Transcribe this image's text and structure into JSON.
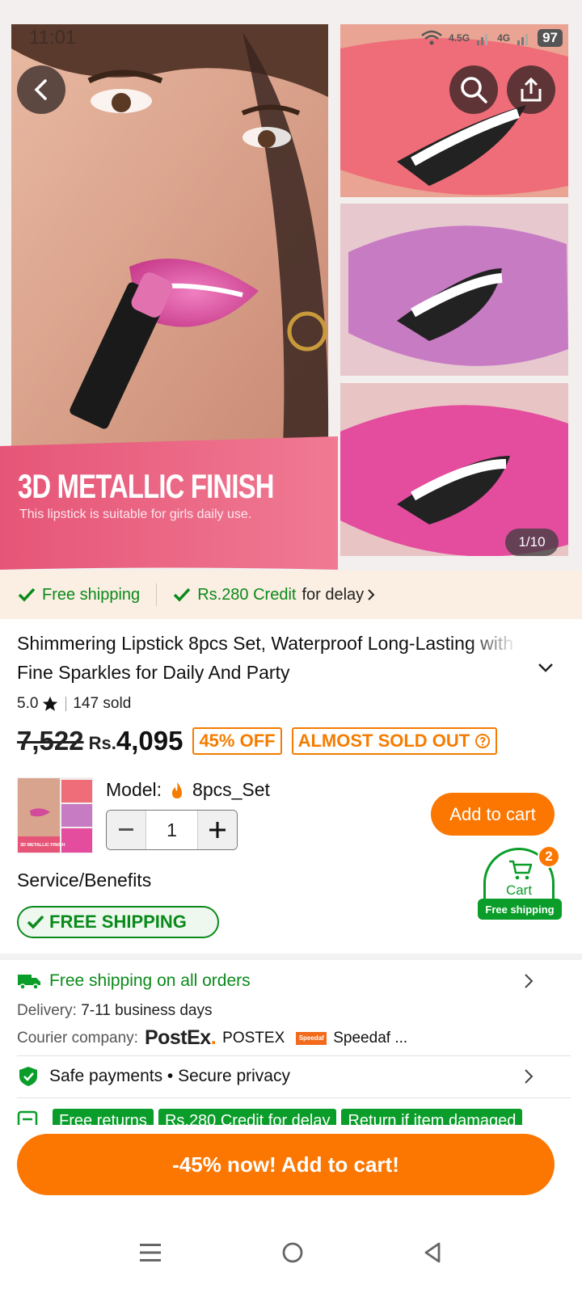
{
  "status_bar": {
    "time": "11:01",
    "network_1": "4.5G",
    "network_2": "4G",
    "battery": "97"
  },
  "hero": {
    "headline": "3D METALLIC FINISH",
    "subline": "This lipstick is suitable for girls daily use.",
    "pager": "1/10"
  },
  "shipping_strip": {
    "free_shipping": "Free shipping",
    "credit": "Rs.280 Credit",
    "credit_suffix": "for delay"
  },
  "product": {
    "title": "Shimmering Lipstick 8pcs Set, Waterproof Long-Lasting with Fine Sparkles for Daily And Party",
    "rating": "5.0",
    "sold": "147 sold",
    "old_price": "7,522",
    "currency": "Rs.",
    "price": "4,095",
    "discount": "45% OFF",
    "stock_tag": "ALMOST SOLD OUT"
  },
  "model": {
    "label": "Model:",
    "value": "8pcs_Set",
    "thumb_text": "3D METALLIC FINISH",
    "quantity": "1",
    "add_to_cart": "Add to cart"
  },
  "cart_float": {
    "label": "Cart",
    "badge": "2",
    "free_shipping": "Free shipping"
  },
  "service": {
    "label": "Service/Benefits",
    "pill": "FREE SHIPPING"
  },
  "benefits": {
    "free_shipping_all": "Free shipping on all orders",
    "delivery_label": "Delivery:",
    "delivery_value": "7-11 business days",
    "courier_label": "Courier company:",
    "postex_logo": "PostEx",
    "postex_name": "POSTEX",
    "speedaf_logo": "Speedaf",
    "speedaf_name": "Speedaf ...",
    "safe_payments": "Safe payments • Secure privacy",
    "chips": [
      "Free returns",
      "Rs.280 Credit for delay",
      "Return if item damaged"
    ]
  },
  "cta": {
    "label": "-45% now! Add to cart!"
  },
  "colors": {
    "accent": "#fb7701",
    "green": "#0a9d2a",
    "strip_bg": "#fbeee2"
  }
}
